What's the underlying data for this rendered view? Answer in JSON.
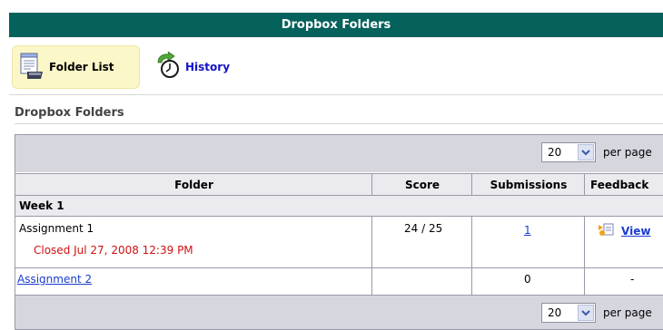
{
  "header": {
    "title": "Dropbox Folders"
  },
  "toolbar": {
    "folder_list": {
      "label": "Folder List",
      "icon": "folder-list-icon"
    },
    "history": {
      "label": "History",
      "icon": "history-clock-icon"
    }
  },
  "section": {
    "title": "Dropbox Folders"
  },
  "pager": {
    "top_value": "20",
    "bottom_value": "20",
    "label": "per page"
  },
  "table": {
    "columns": [
      "Folder",
      "Score",
      "Submissions",
      "Feedback"
    ],
    "groups": [
      {
        "name": "Week 1",
        "rows": [
          {
            "folder": "Assignment 1",
            "folder_is_link": false,
            "status": "Closed Jul 27, 2008 12:39 PM",
            "score": "24 / 25",
            "submissions": "1",
            "submissions_is_link": true,
            "feedback": "View",
            "feedback_icon": "feedback-view-icon"
          },
          {
            "folder": "Assignment 2",
            "folder_is_link": true,
            "status": "",
            "score": "",
            "submissions": "0",
            "submissions_is_link": false,
            "feedback": "-"
          }
        ]
      }
    ]
  },
  "colors": {
    "title_bar": "#05615b",
    "link": "#1a3ccf",
    "closed_status": "#d01010",
    "toolbar_active": "#fbf7c8",
    "pager_bg": "#d6d6df",
    "header_bg": "#eaeaef"
  }
}
